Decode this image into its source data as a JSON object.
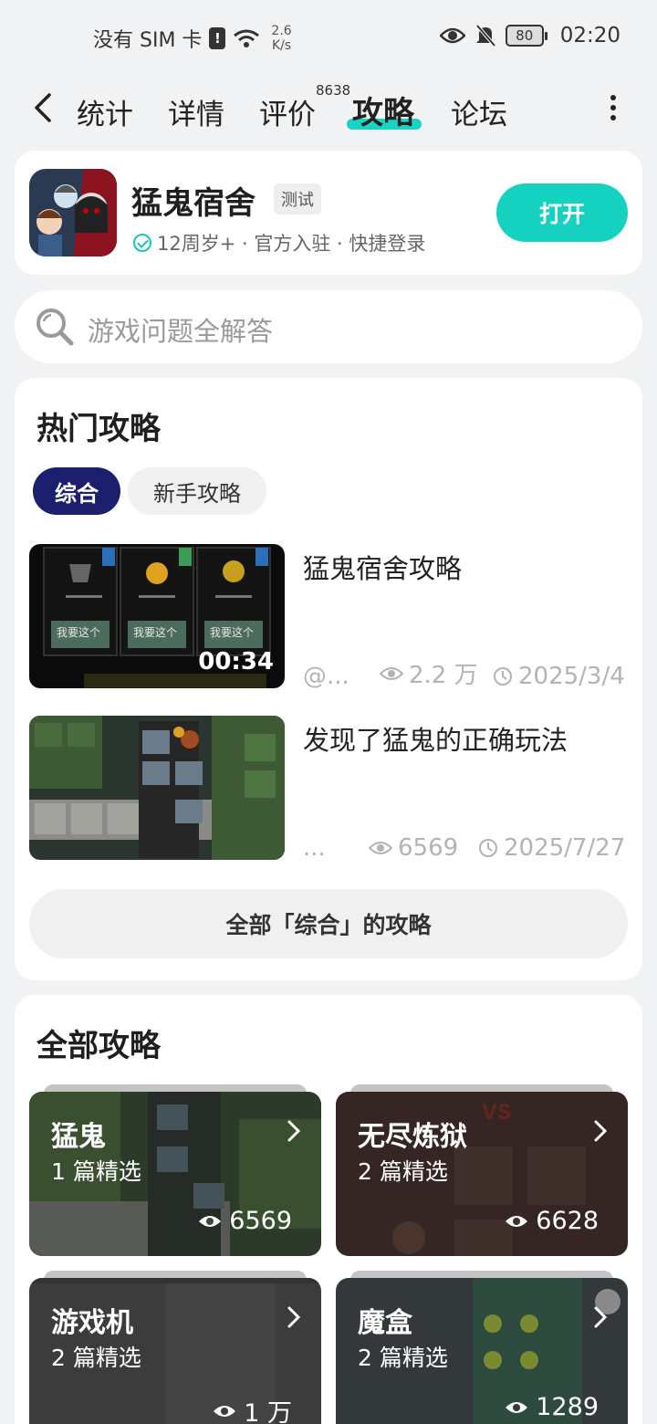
{
  "status_bar": {
    "carrier": "没有 SIM 卡",
    "speed_value": "2.6",
    "speed_unit": "K/s",
    "battery": "80",
    "time": "02:20"
  },
  "nav": {
    "tabs": [
      "统计",
      "详情",
      "评价",
      "攻略",
      "论坛"
    ],
    "active_tab": "攻略",
    "review_count": "8638"
  },
  "app": {
    "name": "猛鬼宿舍",
    "tag": "测试",
    "meta": "12周岁+ · 官方入驻 · 快捷登录",
    "open_label": "打开"
  },
  "search": {
    "placeholder": "游戏问题全解答"
  },
  "hot": {
    "title": "热门攻略",
    "chips": [
      "综合",
      "新手攻略"
    ],
    "articles": [
      {
        "title": "猛鬼宿舍攻略",
        "author": "@...",
        "views": "2.2 万",
        "date": "2025/3/4",
        "duration": "00:34",
        "thumb_buttons": [
          "我要这个",
          "我要这个",
          "我要这个"
        ]
      },
      {
        "title": "发现了猛鬼的正确玩法",
        "author": "...",
        "views": "6569",
        "date": "2025/7/27"
      }
    ],
    "all_button": "全部「综合」的攻略"
  },
  "all": {
    "title": "全部攻略",
    "categories": [
      {
        "name": "猛鬼",
        "count": "1 篇精选",
        "views": "6569"
      },
      {
        "name": "无尽炼狱",
        "count": "2 篇精选",
        "views": "6628"
      },
      {
        "name": "游戏机",
        "count": "2 篇精选",
        "views": "1 万"
      },
      {
        "name": "魔盒",
        "count": "2 篇精选",
        "views": "1289"
      }
    ]
  },
  "colors": {
    "accent": "#15d2c0",
    "chip_active": "#1c1f6e",
    "background": "#f1f2f4"
  }
}
